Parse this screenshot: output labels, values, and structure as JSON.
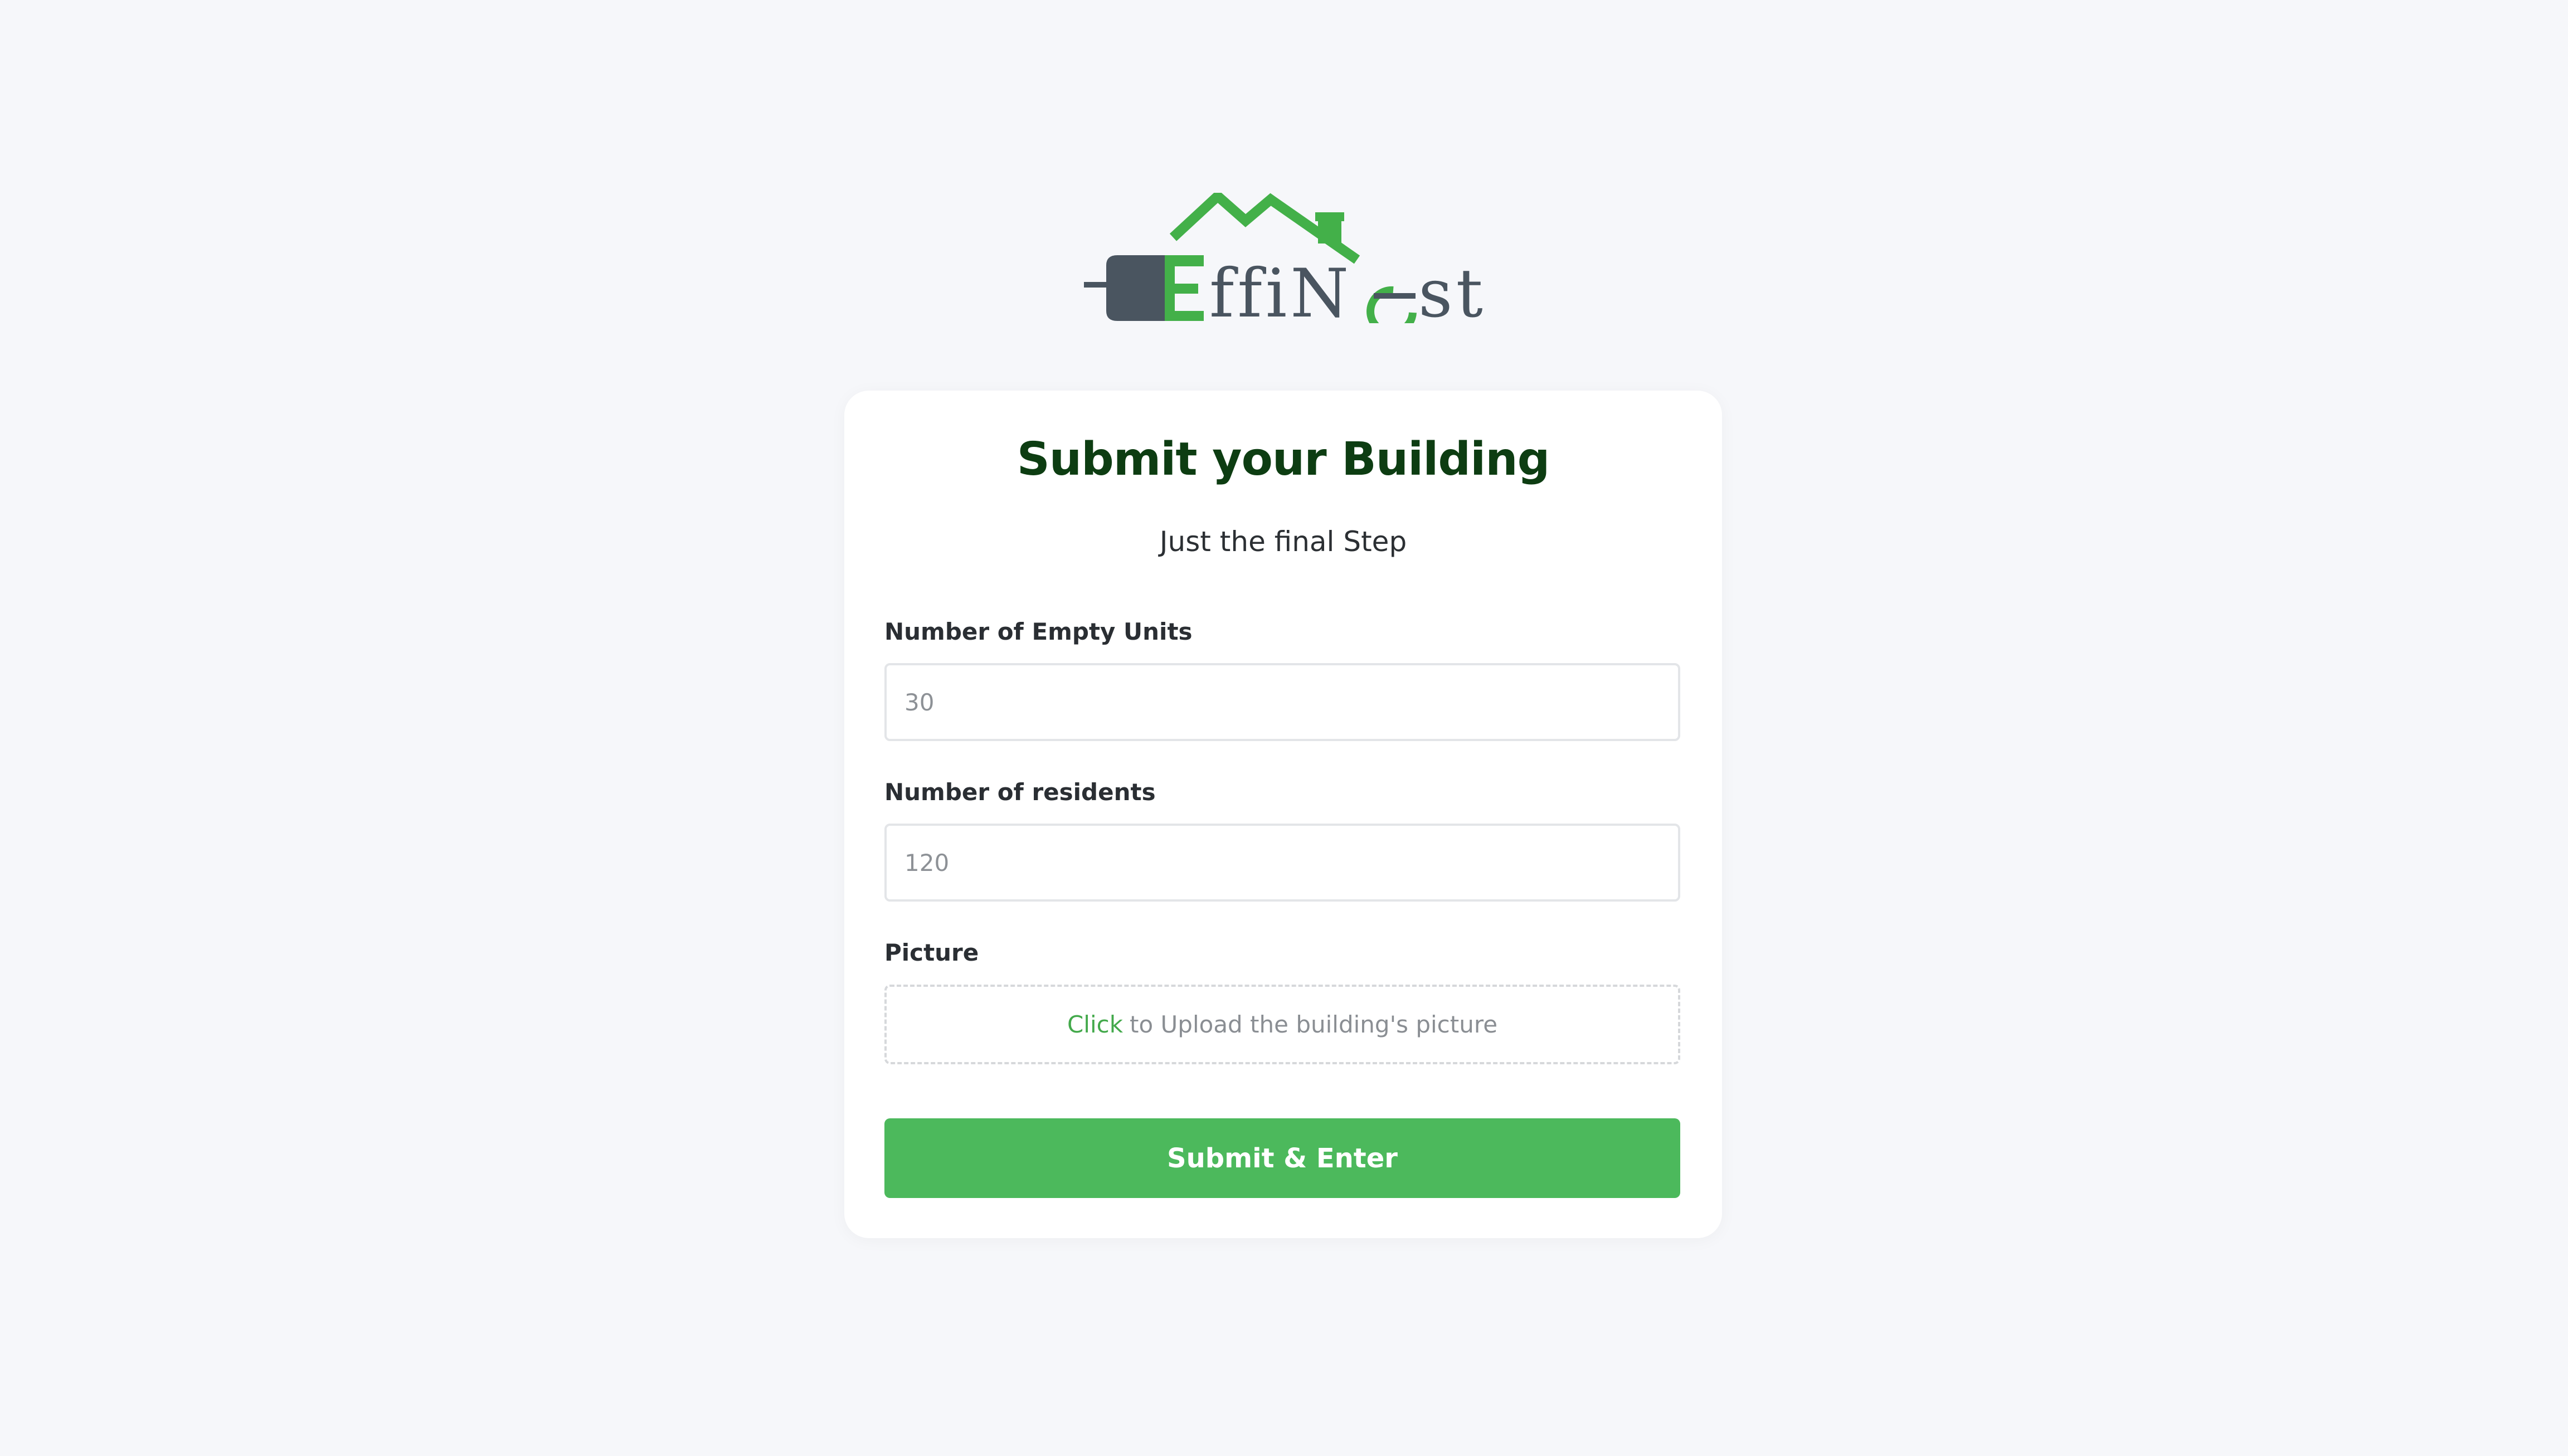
{
  "brand": {
    "logo_text": "EffiNest",
    "colors": {
      "green": "#43b049",
      "slate": "#4a5560",
      "title": "#0d3d12",
      "button": "#4cb95c"
    }
  },
  "form": {
    "title": "Submit your Building",
    "subtitle": "Just the final Step",
    "empty_units": {
      "label": "Number of Empty Units",
      "placeholder": "30"
    },
    "residents": {
      "label": "Number of residents",
      "placeholder": "120"
    },
    "picture": {
      "label": "Picture",
      "click_text": "Click",
      "rest_text": "to Upload the building's picture"
    },
    "submit_label": "Submit & Enter"
  }
}
